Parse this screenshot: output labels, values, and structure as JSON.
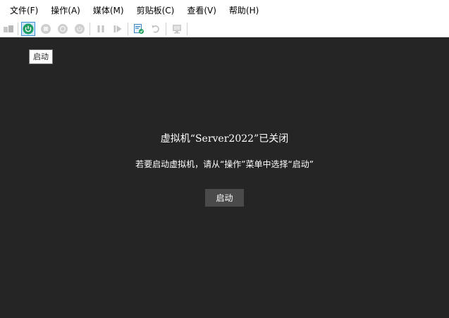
{
  "menu": {
    "file": "文件(F)",
    "action": "操作(A)",
    "media": "媒体(M)",
    "clipboard": "剪贴板(C)",
    "view": "查看(V)",
    "help": "帮助(H)"
  },
  "toolbar": {
    "buttons": [
      {
        "icon": "ctrl-alt-del-icon",
        "enabled": false
      },
      {
        "icon": "power-on-icon",
        "enabled": true,
        "active": true
      },
      {
        "icon": "turn-off-icon",
        "enabled": false
      },
      {
        "icon": "shutdown-icon",
        "enabled": false
      },
      {
        "icon": "save-state-icon",
        "enabled": false
      },
      {
        "icon": "pause-icon",
        "enabled": false
      },
      {
        "icon": "resume-icon",
        "enabled": false
      },
      {
        "icon": "checkpoint-icon",
        "enabled": true
      },
      {
        "icon": "revert-icon",
        "enabled": false
      },
      {
        "icon": "enhanced-session-icon",
        "enabled": false
      }
    ]
  },
  "tooltip": {
    "text": "启动"
  },
  "main": {
    "title": "虚拟机“Server2022”已关闭",
    "hint": "若要启动虚拟机，请从“操作”菜单中选择“启动”",
    "start_button": "启动"
  },
  "colors": {
    "background": "#252525",
    "button_bg": "#4a4a4a",
    "active_border": "#3a8fd6",
    "power_green": "#1f9e63"
  }
}
